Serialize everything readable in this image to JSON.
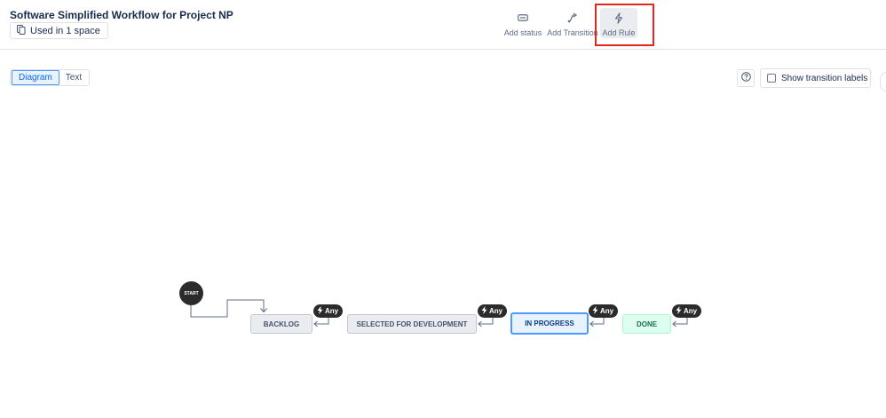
{
  "header": {
    "title": "Software Simplified Workflow for Project NP",
    "usage_label": "Used in 1 space"
  },
  "toolbar": {
    "add_status_label": "Add status",
    "add_transition_label": "Add Transition",
    "add_rule_label": "Add Rule",
    "highlight_color": "#e5281b"
  },
  "view_toggle": {
    "diagram_label": "Diagram",
    "text_label": "Text",
    "selected": "Diagram"
  },
  "options": {
    "show_transition_labels_label": "Show transition labels",
    "show_transition_labels_checked": false
  },
  "workflow": {
    "start_label": "START",
    "any_label": "Any",
    "statuses": [
      {
        "label": "BACKLOG",
        "category": "todo"
      },
      {
        "label": "SELECTED FOR DEVELOPMENT",
        "category": "todo"
      },
      {
        "label": "IN PROGRESS",
        "category": "in-progress"
      },
      {
        "label": "DONE",
        "category": "done"
      }
    ],
    "colors": {
      "todo_bg": "#ebecf0",
      "in_progress_bg": "#e9f2ff",
      "in_progress_border": "#4c9aff",
      "done_bg": "#dcfff1"
    }
  }
}
